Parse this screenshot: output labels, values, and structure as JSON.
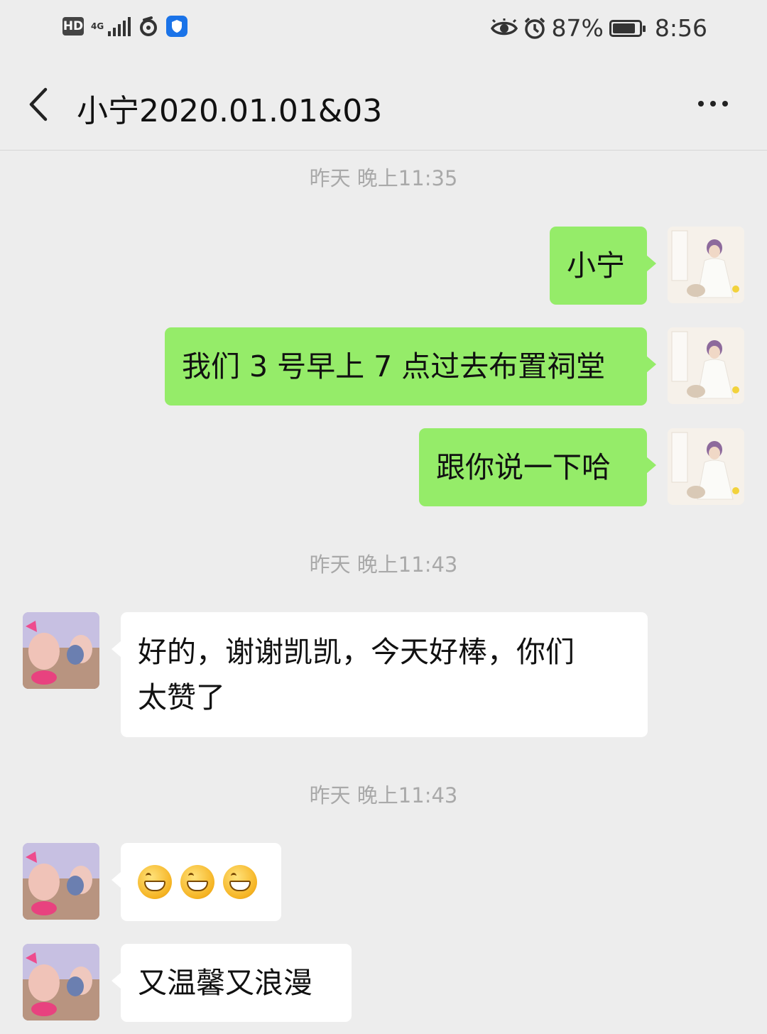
{
  "status_bar": {
    "hd": "HD",
    "network": "4G",
    "battery_percent": "87%",
    "battery_level": 0.87,
    "time": "8:56"
  },
  "header": {
    "title": "小宁2020.01.01&03",
    "icons": {
      "back": "chevron-left-icon",
      "more": "more-dots-icon"
    }
  },
  "messages": {
    "t1": "昨天 晚上11:35",
    "m1": "小宁",
    "m2": "我们 3 号早上 7 点过去布置祠堂",
    "m3": "跟你说一下哈",
    "t2": "昨天 晚上11:43",
    "m4_line1": "好的，谢谢凯凯，今天好棒，你们",
    "m4_line2": "太赞了",
    "t3": "昨天 晚上11:43",
    "m5_emoji": [
      "grin",
      "grin",
      "grin"
    ],
    "m6": "又温馨又浪漫"
  },
  "colors": {
    "background": "#ededed",
    "outgoing_bubble": "#95ec69",
    "incoming_bubble": "#ffffff",
    "timestamp": "#a9a9a9"
  }
}
